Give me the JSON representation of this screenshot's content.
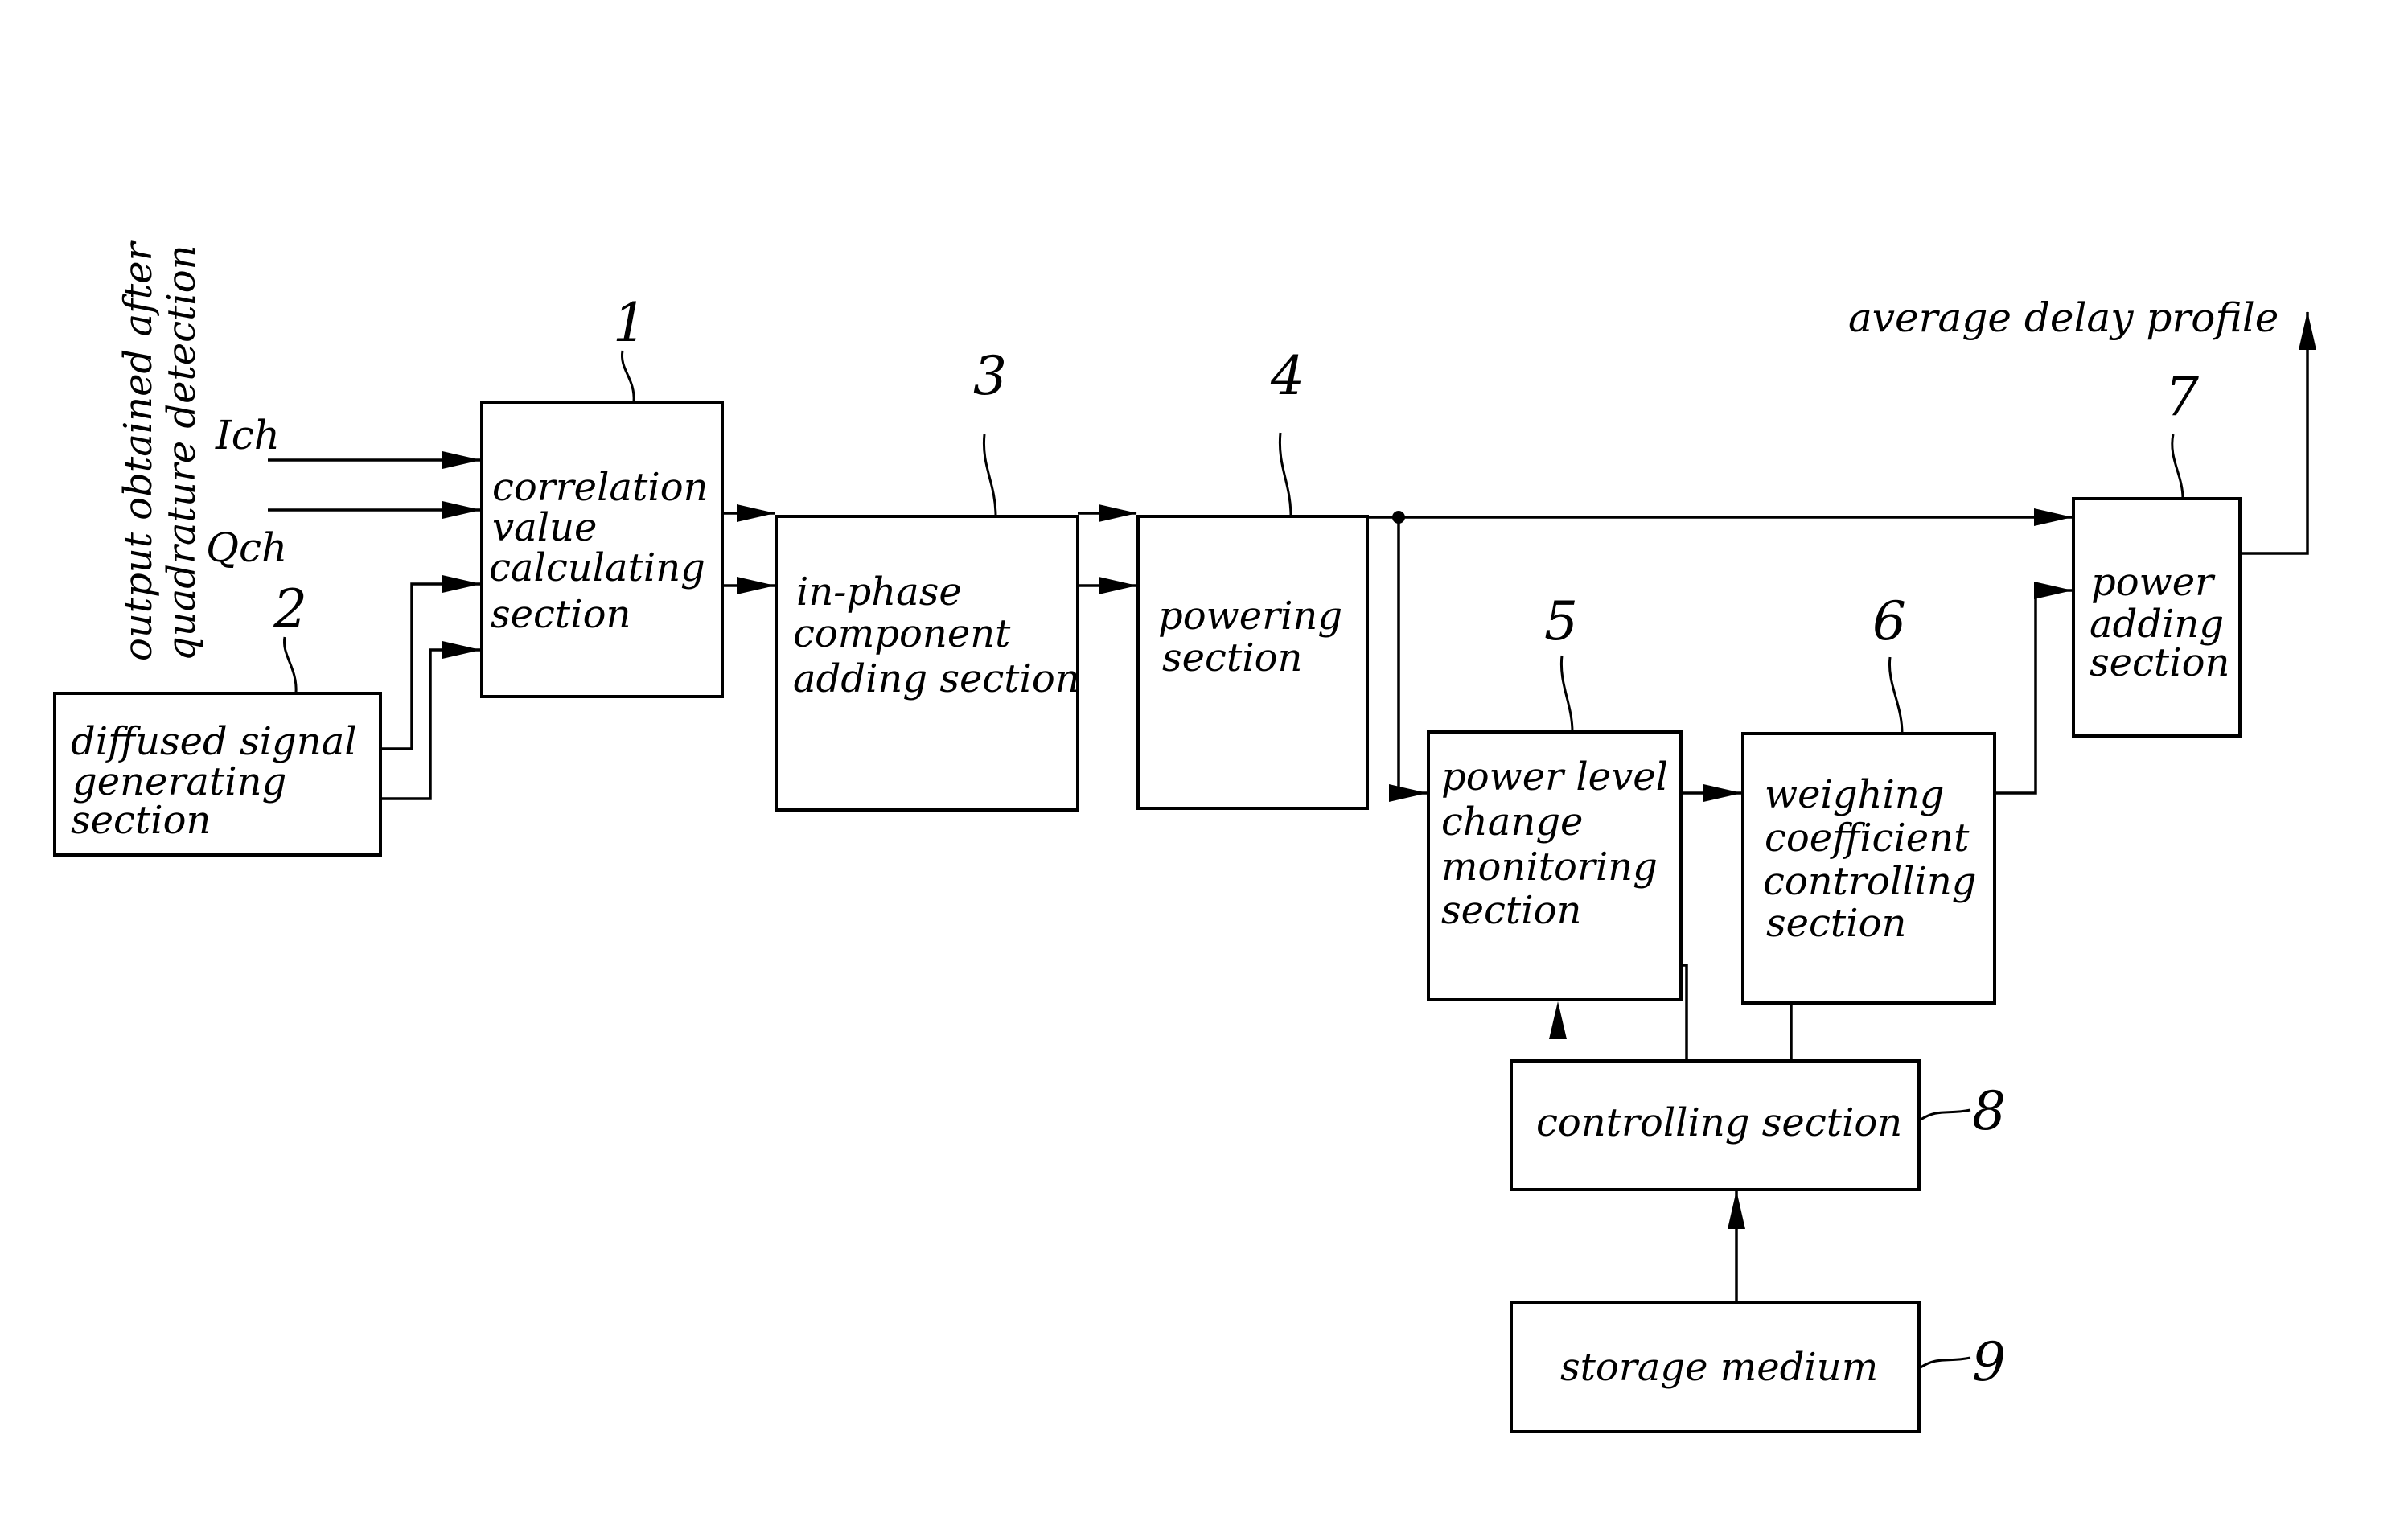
{
  "diagram": {
    "input_caption": [
      "output obtained after",
      "quadrature detection"
    ],
    "signals": {
      "ich": "Ich",
      "qch": "Qch",
      "output": "average delay profile"
    },
    "blocks": [
      {
        "id": "1",
        "lines": [
          "correlation",
          "value",
          "calculating",
          "section"
        ]
      },
      {
        "id": "2",
        "lines": [
          "diffused signal",
          "generating",
          "section"
        ]
      },
      {
        "id": "3",
        "lines": [
          "in-phase",
          "component",
          "adding section"
        ]
      },
      {
        "id": "4",
        "lines": [
          "powering",
          "section"
        ]
      },
      {
        "id": "5",
        "lines": [
          "power level",
          "change",
          "monitoring",
          "section"
        ]
      },
      {
        "id": "6",
        "lines": [
          "weighing",
          "coefficient",
          "controlling",
          "section"
        ]
      },
      {
        "id": "7",
        "lines": [
          "power",
          "adding",
          "section"
        ]
      },
      {
        "id": "8",
        "lines": [
          "controlling section"
        ]
      },
      {
        "id": "9",
        "lines": [
          "storage medium"
        ]
      }
    ],
    "connections": [
      {
        "from": "Ich",
        "to": "1"
      },
      {
        "from": "Qch",
        "to": "1"
      },
      {
        "from": "2",
        "to": "1"
      },
      {
        "from": "2",
        "to": "1"
      },
      {
        "from": "1",
        "to": "3"
      },
      {
        "from": "1",
        "to": "3"
      },
      {
        "from": "3",
        "to": "4"
      },
      {
        "from": "3",
        "to": "4"
      },
      {
        "from": "4",
        "to": "7"
      },
      {
        "from": "4",
        "to": "5"
      },
      {
        "from": "5",
        "to": "6"
      },
      {
        "from": "6",
        "to": "7"
      },
      {
        "from": "8",
        "to": "5"
      },
      {
        "from": "8",
        "to": "6"
      },
      {
        "from": "9",
        "to": "8"
      },
      {
        "from": "7",
        "to": "average delay profile"
      }
    ]
  }
}
